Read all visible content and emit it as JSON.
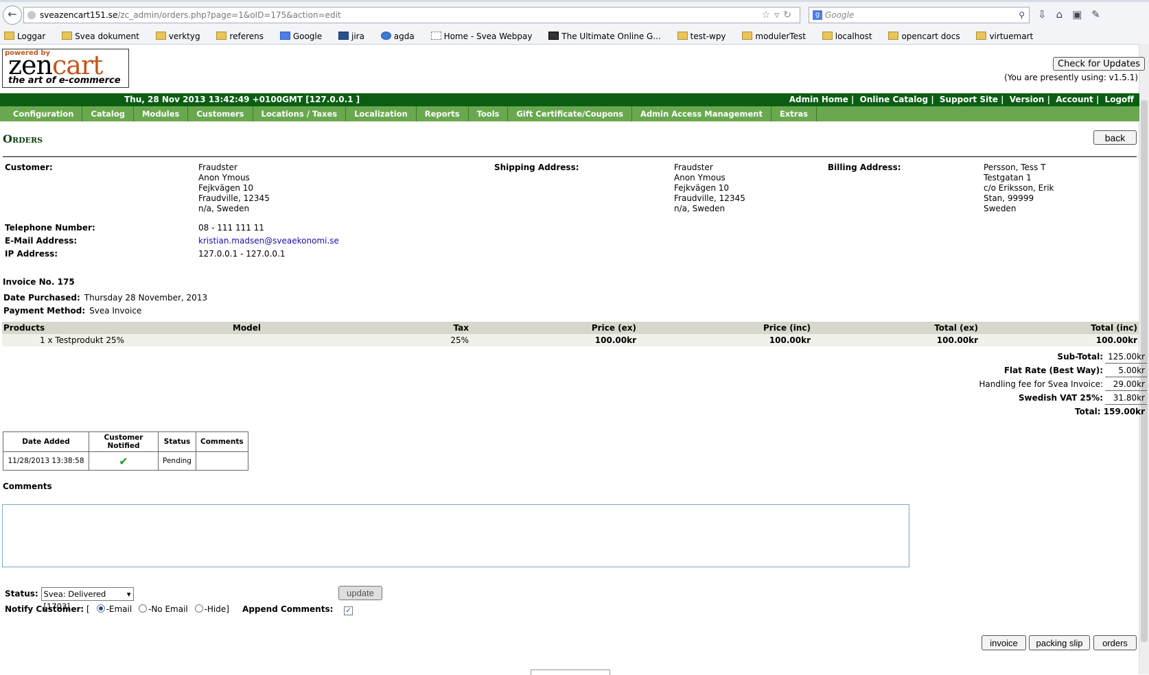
{
  "browser": {
    "url_host": "sveazencart151.se",
    "url_path": "/zc_admin/orders.php?page=1&oID=175&action=edit",
    "search_placeholder": "Google",
    "bookmarks": [
      "Loggar",
      "Svea dokument",
      "verktyg",
      "referens",
      "Google",
      "jira",
      "agda",
      "Home - Svea Webpay",
      "The Ultimate Online G...",
      "test-wpy",
      "modulerTest",
      "localhost",
      "opencart docs",
      "virtuemart"
    ]
  },
  "header": {
    "logo_powered": "powered by",
    "logo_zen": "zen",
    "logo_cart": "cart",
    "logo_tagline": "the art of e-commerce",
    "check_updates": "Check for Updates",
    "version_text": "(You are presently using: v1.5.1)",
    "datetime": "Thu, 28 Nov 2013 13:42:49 +0100GMT [127.0.0.1 ]",
    "top_links": [
      "Admin Home",
      "Online Catalog",
      "Support Site",
      "Version",
      "Account",
      "Logoff"
    ]
  },
  "menu": [
    "Configuration",
    "Catalog",
    "Modules",
    "Customers",
    "Locations / Taxes",
    "Localization",
    "Reports",
    "Tools",
    "Gift Certificate/Coupons",
    "Admin Access Management",
    "Extras"
  ],
  "page": {
    "title": "Orders",
    "back_label": "back"
  },
  "customer": {
    "customer_label": "Customer:",
    "customer_lines": [
      "Fraudster",
      "Anon Ymous",
      "Fejkvägen 10",
      "Fraudville, 12345",
      "n/a, Sweden"
    ],
    "shipping_label": "Shipping Address:",
    "shipping_lines": [
      "Fraudster",
      "Anon Ymous",
      "Fejkvägen 10",
      "Fraudville, 12345",
      "n/a, Sweden"
    ],
    "billing_label": "Billing Address:",
    "billing_lines": [
      "Persson, Tess T",
      "Testgatan 1",
      "c/o Eriksson, Erik",
      "Stan, 99999",
      "Sweden"
    ],
    "phone_label": "Telephone Number:",
    "phone": "08 - 111 111 11",
    "email_label": "E-Mail Address:",
    "email": "kristian.madsen@sveaekonomi.se",
    "ip_label": "IP Address:",
    "ip": "127.0.0.1 - 127.0.0.1"
  },
  "order": {
    "invoice": "Invoice No. 175",
    "date_label": "Date Purchased:",
    "date": "Thursday 28 November, 2013",
    "payment_label": "Payment Method:",
    "payment": "Svea Invoice"
  },
  "products": {
    "headers": [
      "Products",
      "Model",
      "Tax",
      "Price (ex)",
      "Price (inc)",
      "Total (ex)",
      "Total (inc)"
    ],
    "rows": [
      [
        "1 x Testprodukt 25%",
        "",
        "25%",
        "100.00kr",
        "100.00kr",
        "100.00kr",
        "100.00kr"
      ]
    ]
  },
  "totals": [
    {
      "label": "Sub-Total:",
      "value": "125.00kr"
    },
    {
      "label": "Flat Rate (Best Way):",
      "value": "5.00kr"
    },
    {
      "label": "Handling fee for Svea Invoice:",
      "value": "29.00kr"
    },
    {
      "label": "Swedish VAT 25%:",
      "value": "31.80kr"
    },
    {
      "label": "Total:",
      "value": "159.00kr"
    }
  ],
  "history": {
    "headers": [
      "Date Added",
      "Customer Notified",
      "Status",
      "Comments"
    ],
    "row": {
      "date": "11/28/2013 13:38:58",
      "status": "Pending",
      "comments": ""
    }
  },
  "comments_label": "Comments",
  "status_form": {
    "status_label": "Status:",
    "status_value": "Svea: Delivered [1703]",
    "update_label": "update",
    "notify_label": "Notify Customer:",
    "open_bracket": "[",
    "close_bracket": "]",
    "opt_email": "-Email",
    "opt_noemail": "-No Email",
    "opt_hide": "-Hide",
    "append_label": "Append Comments:"
  },
  "bottom_buttons": [
    "invoice",
    "packing slip",
    "orders"
  ]
}
